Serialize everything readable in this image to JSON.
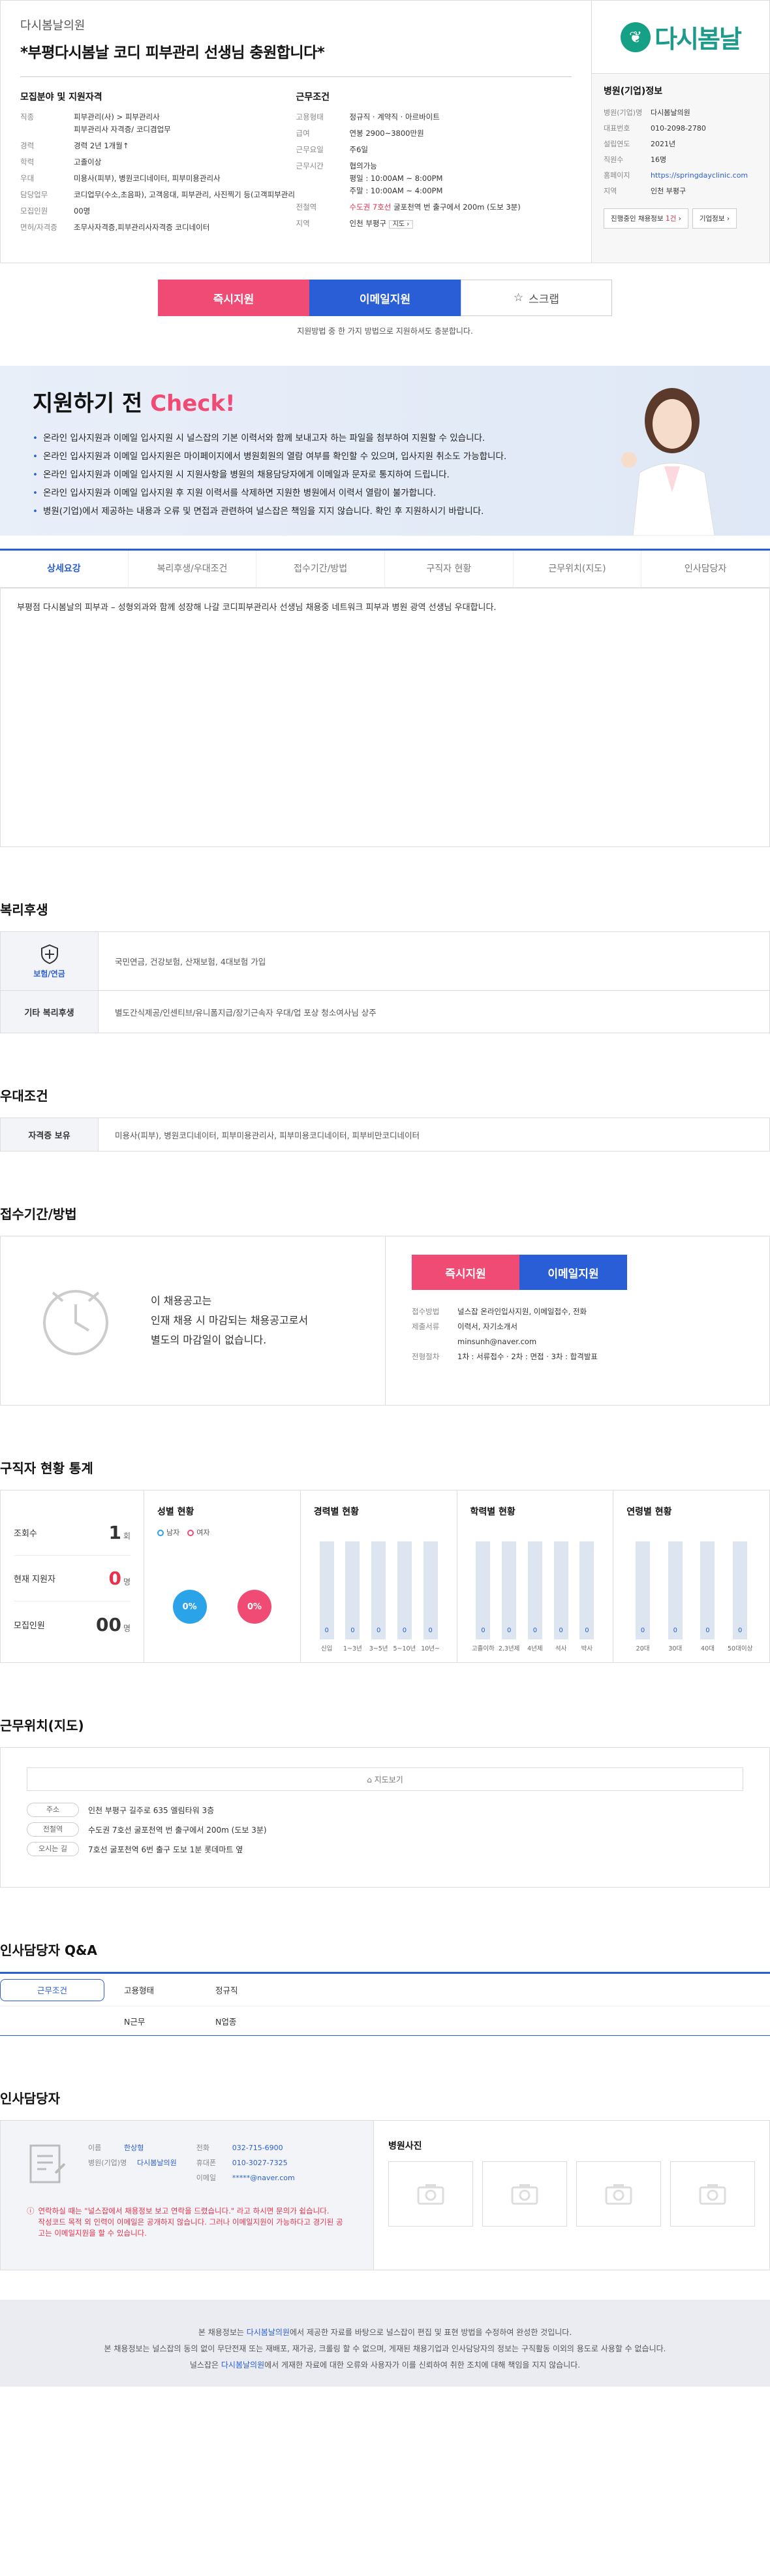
{
  "header": {
    "hospital": "다시봄날의원",
    "title": "*부평다시봄날 코디 피부관리 선생님 충원합니다*"
  },
  "recruit": {
    "heading": "모집분야 및 지원자격",
    "rows": [
      {
        "k": "직종",
        "v": "피부관리(사) > 피부관리사\n피부관리사 자격증/ 코디겸업무"
      },
      {
        "k": "경력",
        "v": "경력 2년 1개월↑"
      },
      {
        "k": "학력",
        "v": "고졸이상"
      },
      {
        "k": "우대",
        "v": "미용사(피부), 병원코디네이터, 피부미용관리사"
      },
      {
        "k": "담당업무",
        "v": "코디업무(수소,초음파), 고객응대, 피부관리, 사진찍기 등(고객피부관리"
      },
      {
        "k": "모집인원",
        "v": "00명"
      },
      {
        "k": "면허/자격증",
        "v": "조무사자격증,피부관리사자격증 코디네이터"
      }
    ]
  },
  "work": {
    "heading": "근무조건",
    "type_k": "고용형태",
    "type_1": "정규직",
    "type_2": "계약직",
    "type_3": "아르바이트",
    "pay_k": "급여",
    "pay_v": "연봉 2900~3800만원",
    "days_k": "근무요일",
    "days_v": "주6일",
    "hours_k": "근무시간",
    "hours_v": "협의가능\n평일 : 10:00AM ~ 8:00PM\n주말 : 10:00AM ~ 4:00PM",
    "station_k": "전철역",
    "station_line": "수도권 7호선",
    "station_v": "굴포천역 번 출구에서 200m (도보 3분)",
    "area_k": "지역",
    "area_v": "인천 부평구",
    "area_btn": "지도"
  },
  "company": {
    "logo_text": "다시봄날",
    "heading": "병원(기업)정보",
    "rows": [
      {
        "k": "병원(기업)명",
        "v": "다시봄날의원"
      },
      {
        "k": "대표번호",
        "v": "010-2098-2780"
      },
      {
        "k": "설립연도",
        "v": "2021년"
      },
      {
        "k": "직원수",
        "v": "16명"
      },
      {
        "k": "홈페이지",
        "v": "https://springdayclinic.com"
      },
      {
        "k": "지역",
        "v": "인천 부평구"
      }
    ],
    "btn1_pre": "진행중인 채용정보 ",
    "btn1_count": "1건",
    "btn2": "기업정보"
  },
  "apply": {
    "now": "즉시지원",
    "email": "이메일지원",
    "scrap": "스크랩",
    "note": "지원방법 중 한 가지 방법으로 지원하셔도 충분합니다."
  },
  "check": {
    "title_pre": "지원하기 전 ",
    "title_hl": "Check!",
    "items": [
      "온라인 입사지원과 이메일 입사지원 시 널스잡의 기본 이력서와 함께 보내고자 하는 파일을 첨부하여 지원할 수 있습니다.",
      "온라인 입사지원과 이메일 입사지원은 마이페이지에서 병원회원의 열람 여부를 확인할 수 있으며, 입사지원 취소도 가능합니다.",
      "온라인 입사지원과 이메일 입사지원 시 지원사항을 병원의 채용담당자에게 이메일과 문자로 통지하여 드립니다.",
      "온라인 입사지원과 이메일 입사지원 후 지원 이력서를 삭제하면 지원한 병원에서 이력서 열람이 불가합니다.",
      "병원(기업)에서 제공하는 내용과 오류 및 면접과 관련하여 널스잡은 책임을 지지 않습니다. 확인 후 지원하시기 바랍니다."
    ]
  },
  "tabs": [
    "상세요강",
    "복리후생/우대조건",
    "접수기간/방법",
    "구직자 현황",
    "근무위치(지도)",
    "인사담당자"
  ],
  "detail_text": "부평점 다시봄날의 피부과 – 성형외과와 함께 성장해 나갈 코디피부관리사 선생님 채용중 네트워크 피부과 병원 광역 선생님 우대합니다.",
  "welfare": {
    "title": "복리후생",
    "k1": "보험/연금",
    "v1": "국민연금, 건강보험, 산재보험, 4대보험 가입",
    "k2": "기타 복리후생",
    "v2": "별도간식제공/인센티브/유니폼지급/장기근속자 우대/업 포상 청소여사님 상주"
  },
  "pref": {
    "title": "우대조건",
    "k": "자격증 보유",
    "v": "미용사(피부), 병원코디네이터, 피부미용관리사, 피부미용코디네이터, 피부비만코디네이터"
  },
  "recep": {
    "title": "접수기간/방법",
    "text1": "이 채용공고는",
    "text2": "인재 채용 시 마감되는 채용공고로서",
    "text3": "별도의 마감일이 없습니다.",
    "now": "즉시지원",
    "email": "이메일지원",
    "rows": [
      {
        "k": "접수방법",
        "v": "널스잡 온라인입사지원, 이메일접수, 전화"
      },
      {
        "k": "제출서류",
        "v": "이력서, 자기소개서\nminsunh@naver.com"
      },
      {
        "k": "전형절차",
        "v": "1차 : 서류접수 · 2차 : 면접 · 3차 : 합격발표"
      }
    ]
  },
  "stats": {
    "title": "구직자 현황 통계",
    "views_k": "조회수",
    "views_v": "1",
    "views_u": "회",
    "now_k": "현재 지원자",
    "now_v": "0",
    "now_u": "명",
    "total_k": "모집인원",
    "total_v": "00",
    "total_u": "명",
    "gender_h": "성별 현황",
    "male": "남자",
    "female": "여자",
    "male_v": "0%",
    "female_v": "0%",
    "career_h": "경력별 현황",
    "career": [
      {
        "l": "신입",
        "v": "0"
      },
      {
        "l": "1~3년",
        "v": "0"
      },
      {
        "l": "3~5년",
        "v": "0"
      },
      {
        "l": "5~10년",
        "v": "0"
      },
      {
        "l": "10년~",
        "v": "0"
      }
    ],
    "edu_h": "학력별 현황",
    "edu": [
      {
        "l": "고졸이하",
        "v": "0"
      },
      {
        "l": "2,3년제",
        "v": "0"
      },
      {
        "l": "4년제",
        "v": "0"
      },
      {
        "l": "석사",
        "v": "0"
      },
      {
        "l": "박사",
        "v": "0"
      }
    ],
    "age_h": "연령별 현황",
    "age": [
      {
        "l": "20대",
        "v": "0"
      },
      {
        "l": "30대",
        "v": "0"
      },
      {
        "l": "40대",
        "v": "0"
      },
      {
        "l": "50대이상",
        "v": "0"
      }
    ]
  },
  "loc": {
    "title": "근무위치(지도)",
    "map_btn": "지도보기",
    "rows": [
      {
        "k": "주소",
        "v": "인천 부평구 길주로 635 엘림타워 3층"
      },
      {
        "k": "전철역",
        "v": "수도권 7호선 굴포천역 번 출구에서 200m (도보 3분)"
      },
      {
        "k": "오시는 길",
        "v": "7호선 굴포천역 6번 출구 도보 1분 롯데마트 옆"
      }
    ]
  },
  "qa": {
    "title": "인사담당자 Q&A",
    "h1": "근무조건",
    "h2": "고용형태",
    "h3": "정규직",
    "r1": "N근무",
    "r2": "N업종"
  },
  "mgr": {
    "title": "인사담당자",
    "name_k": "이름",
    "name_v": "한상형",
    "org_k": "병원(기업)명",
    "org_v": "다시봄날의원",
    "tel_k": "전화",
    "tel_v": "032-715-6900",
    "mobile_k": "휴대폰",
    "mobile_v": "010-3027-7325",
    "mail_k": "이메일",
    "mail_v": "*****@naver.com",
    "warn": "연락하실 때는 \"널스잡에서 채용정보 보고 연락을 드렸습니다.\" 라고 하시면 문의가 쉽습니다.\n작성코드 목적 외 인력이 이메일은 공개하지 않습니다. 그러나 이메일지원이 가능하다고 경기된 공고는 이메일지원을 할 수 있습니다.",
    "photo_h": "병원사진"
  },
  "footer": {
    "l1_pre": "본 채용정보는 ",
    "l1_hl": "다시봄날의원",
    "l1_post": "에서 제공한 자료를 바탕으로 널스잡이 편집 및 표현 방법을 수정하여 완성한 것입니다.",
    "l2": "본 채용정보는 널스잡의 동의 없이 무단전재 또는 재배포, 재가공, 크롤링 할 수 없으며, 게재된 채용기업과 인사담당자의 정보는 구직활동 이외의 용도로 사용할 수 없습니다.",
    "l3_pre": "널스잡은 ",
    "l3_hl": "다시봄날의원",
    "l3_post": "에서 게재한 자료에 대한 오류와 사용자가 이를 신뢰하여 취한 조치에 대해 책임을 지지 않습니다."
  }
}
